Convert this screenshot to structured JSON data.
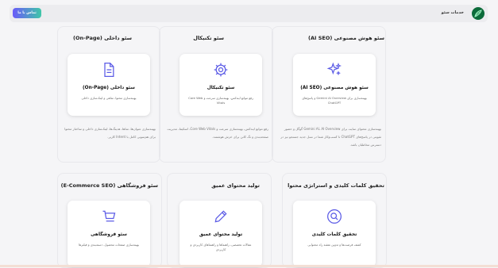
{
  "header": {
    "nav_label": "خدمات سئو",
    "cta_label": "تماس با ما"
  },
  "row1": [
    {
      "section_title": "سئو هوش مصنوعی (AI SEO)",
      "card_title": "سئو هوش مصنوعی (AI SEO)",
      "card_desc": "بهینه‌سازی برای Gemini AI Overview و پاسخ‌های ChatGPT",
      "icon": "sparkles-icon",
      "desc": "بهینه‌سازی محتوای سایت برای Gemini AI، AI Overview گوگل و حضور تقویتی در پاسخ‌های ChatGPT تا کسب‌وکار شما در نسل جدید جستجو نیز در دسترس مخاطبان باشد."
    },
    {
      "section_title": "سئو تکنیکال",
      "card_title": "سئو تکنیکال",
      "card_desc": "رفع موانع ایندکس، بهینه‌سازی سرعت و Core Web Vitals",
      "icon": "gear-icon",
      "desc": "رفع موانع ایندکس، بهینه‌سازی سرعت و Core Web Vitals، اسکیما، مدیریت صفحه‌بندی و تگ کانن برای خزش هوشمند."
    },
    {
      "section_title": "سئو داخلی (On-Page)",
      "card_title": "سئو داخلی (On-Page)",
      "card_desc": "بهینه‌سازی محتوا، متاهی و لینک‌سازی داخلی",
      "icon": "document-icon",
      "desc": "بهینه‌سازی عنوان‌ها، متاها، هدینگ‌ها، لینک‌سازی داخلی و ساختار محتوا برای هم‌سویی کامل با Intent کاربر."
    }
  ],
  "row2": [
    {
      "section_title": "تحقیق کلمات کلیدی و استراتژی محتوا",
      "card_title": "تحقیق کلمات کلیدی",
      "card_desc": "کشف فرصت‌ها و تدوین نقشه راه محتوایی",
      "icon": "search-icon"
    },
    {
      "section_title": "تولید محتوای عمیق",
      "card_title": "تولید محتوای عمیق",
      "card_desc": "مقالات تخصصی، راهنماها و راهنماهای کاربردی و کاربردی",
      "icon": "pen-icon"
    },
    {
      "section_title": "سئو فروشگاهی (E-Commerce SEO)",
      "card_title": "سئو فروشگاهی",
      "card_desc": "بهینه‌سازی صفحات محصول، دسته‌بندی و فیلترها",
      "icon": "cart-icon"
    }
  ],
  "colors": {
    "accent": "#5b5be6",
    "cta_start": "#6a5af9",
    "cta_end": "#3fc7a8",
    "logo": "#0c6b3a"
  }
}
